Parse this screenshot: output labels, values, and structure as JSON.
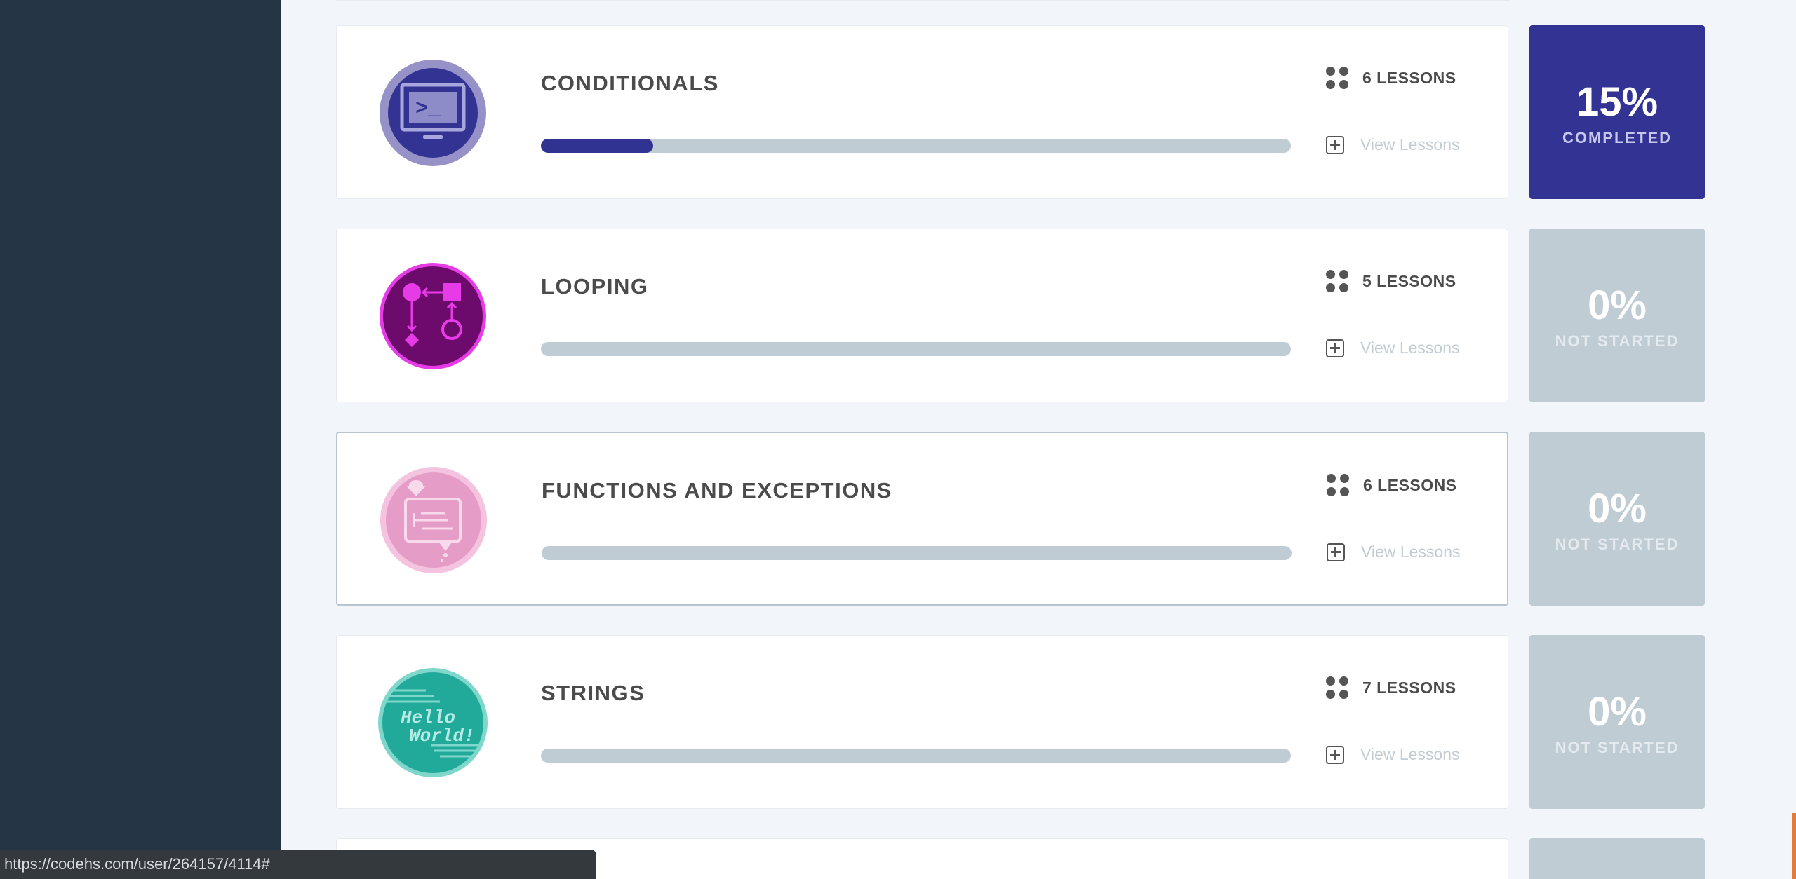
{
  "courses": [
    {
      "title": "CONDITIONALS",
      "lessons": "6 LESSONS",
      "view_label": "View Lessons",
      "progress_fraction": 0.15,
      "percent": "15%",
      "status": "COMPLETED",
      "icon": "terminal-icon",
      "icon_color": "#323392"
    },
    {
      "title": "LOOPING",
      "lessons": "5 LESSONS",
      "view_label": "View Lessons",
      "progress_fraction": 0,
      "percent": "0%",
      "status": "NOT STARTED",
      "icon": "flowchart-icon",
      "icon_color": "#6d0b6d"
    },
    {
      "title": "FUNCTIONS AND EXCEPTIONS",
      "lessons": "6 LESSONS",
      "view_label": "View Lessons",
      "progress_fraction": 0,
      "percent": "0%",
      "status": "NOT STARTED",
      "icon": "function-machine-icon",
      "icon_color": "#e59dc8"
    },
    {
      "title": "STRINGS",
      "lessons": "7 LESSONS",
      "view_label": "View Lessons",
      "progress_fraction": 0,
      "percent": "0%",
      "status": "NOT STARTED",
      "icon": "hello-world-icon",
      "icon_color": "#21a99a"
    }
  ],
  "icons": {
    "hello_line1": "Hello",
    "hello_line2": "World!"
  },
  "status_url": "https://codehs.com/user/264157/4114#",
  "colors": {
    "sidebar": "#263546",
    "accent": "#313392",
    "not_started": "#bfccd3"
  }
}
